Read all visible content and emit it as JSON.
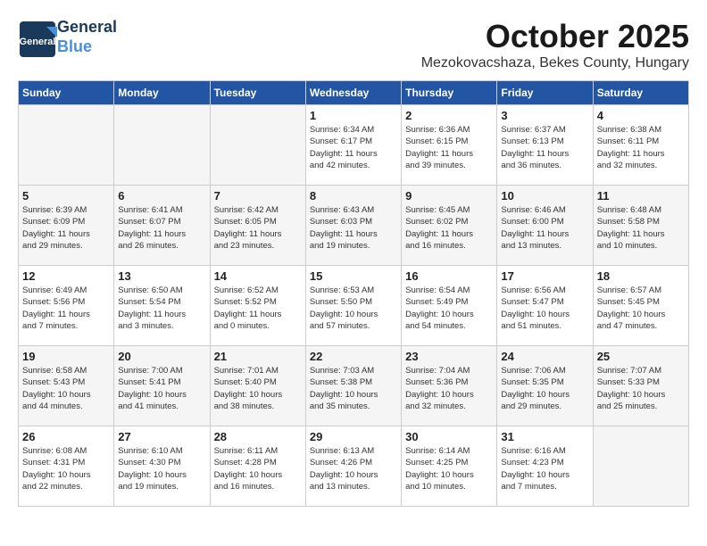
{
  "header": {
    "logo_line1": "General",
    "logo_line2": "Blue",
    "month": "October 2025",
    "location": "Mezokovacshaza, Bekes County, Hungary"
  },
  "days_of_week": [
    "Sunday",
    "Monday",
    "Tuesday",
    "Wednesday",
    "Thursday",
    "Friday",
    "Saturday"
  ],
  "weeks": [
    [
      {
        "day": "",
        "info": ""
      },
      {
        "day": "",
        "info": ""
      },
      {
        "day": "",
        "info": ""
      },
      {
        "day": "1",
        "info": "Sunrise: 6:34 AM\nSunset: 6:17 PM\nDaylight: 11 hours\nand 42 minutes."
      },
      {
        "day": "2",
        "info": "Sunrise: 6:36 AM\nSunset: 6:15 PM\nDaylight: 11 hours\nand 39 minutes."
      },
      {
        "day": "3",
        "info": "Sunrise: 6:37 AM\nSunset: 6:13 PM\nDaylight: 11 hours\nand 36 minutes."
      },
      {
        "day": "4",
        "info": "Sunrise: 6:38 AM\nSunset: 6:11 PM\nDaylight: 11 hours\nand 32 minutes."
      }
    ],
    [
      {
        "day": "5",
        "info": "Sunrise: 6:39 AM\nSunset: 6:09 PM\nDaylight: 11 hours\nand 29 minutes."
      },
      {
        "day": "6",
        "info": "Sunrise: 6:41 AM\nSunset: 6:07 PM\nDaylight: 11 hours\nand 26 minutes."
      },
      {
        "day": "7",
        "info": "Sunrise: 6:42 AM\nSunset: 6:05 PM\nDaylight: 11 hours\nand 23 minutes."
      },
      {
        "day": "8",
        "info": "Sunrise: 6:43 AM\nSunset: 6:03 PM\nDaylight: 11 hours\nand 19 minutes."
      },
      {
        "day": "9",
        "info": "Sunrise: 6:45 AM\nSunset: 6:02 PM\nDaylight: 11 hours\nand 16 minutes."
      },
      {
        "day": "10",
        "info": "Sunrise: 6:46 AM\nSunset: 6:00 PM\nDaylight: 11 hours\nand 13 minutes."
      },
      {
        "day": "11",
        "info": "Sunrise: 6:48 AM\nSunset: 5:58 PM\nDaylight: 11 hours\nand 10 minutes."
      }
    ],
    [
      {
        "day": "12",
        "info": "Sunrise: 6:49 AM\nSunset: 5:56 PM\nDaylight: 11 hours\nand 7 minutes."
      },
      {
        "day": "13",
        "info": "Sunrise: 6:50 AM\nSunset: 5:54 PM\nDaylight: 11 hours\nand 3 minutes."
      },
      {
        "day": "14",
        "info": "Sunrise: 6:52 AM\nSunset: 5:52 PM\nDaylight: 11 hours\nand 0 minutes."
      },
      {
        "day": "15",
        "info": "Sunrise: 6:53 AM\nSunset: 5:50 PM\nDaylight: 10 hours\nand 57 minutes."
      },
      {
        "day": "16",
        "info": "Sunrise: 6:54 AM\nSunset: 5:49 PM\nDaylight: 10 hours\nand 54 minutes."
      },
      {
        "day": "17",
        "info": "Sunrise: 6:56 AM\nSunset: 5:47 PM\nDaylight: 10 hours\nand 51 minutes."
      },
      {
        "day": "18",
        "info": "Sunrise: 6:57 AM\nSunset: 5:45 PM\nDaylight: 10 hours\nand 47 minutes."
      }
    ],
    [
      {
        "day": "19",
        "info": "Sunrise: 6:58 AM\nSunset: 5:43 PM\nDaylight: 10 hours\nand 44 minutes."
      },
      {
        "day": "20",
        "info": "Sunrise: 7:00 AM\nSunset: 5:41 PM\nDaylight: 10 hours\nand 41 minutes."
      },
      {
        "day": "21",
        "info": "Sunrise: 7:01 AM\nSunset: 5:40 PM\nDaylight: 10 hours\nand 38 minutes."
      },
      {
        "day": "22",
        "info": "Sunrise: 7:03 AM\nSunset: 5:38 PM\nDaylight: 10 hours\nand 35 minutes."
      },
      {
        "day": "23",
        "info": "Sunrise: 7:04 AM\nSunset: 5:36 PM\nDaylight: 10 hours\nand 32 minutes."
      },
      {
        "day": "24",
        "info": "Sunrise: 7:06 AM\nSunset: 5:35 PM\nDaylight: 10 hours\nand 29 minutes."
      },
      {
        "day": "25",
        "info": "Sunrise: 7:07 AM\nSunset: 5:33 PM\nDaylight: 10 hours\nand 25 minutes."
      }
    ],
    [
      {
        "day": "26",
        "info": "Sunrise: 6:08 AM\nSunset: 4:31 PM\nDaylight: 10 hours\nand 22 minutes."
      },
      {
        "day": "27",
        "info": "Sunrise: 6:10 AM\nSunset: 4:30 PM\nDaylight: 10 hours\nand 19 minutes."
      },
      {
        "day": "28",
        "info": "Sunrise: 6:11 AM\nSunset: 4:28 PM\nDaylight: 10 hours\nand 16 minutes."
      },
      {
        "day": "29",
        "info": "Sunrise: 6:13 AM\nSunset: 4:26 PM\nDaylight: 10 hours\nand 13 minutes."
      },
      {
        "day": "30",
        "info": "Sunrise: 6:14 AM\nSunset: 4:25 PM\nDaylight: 10 hours\nand 10 minutes."
      },
      {
        "day": "31",
        "info": "Sunrise: 6:16 AM\nSunset: 4:23 PM\nDaylight: 10 hours\nand 7 minutes."
      },
      {
        "day": "",
        "info": ""
      }
    ]
  ]
}
